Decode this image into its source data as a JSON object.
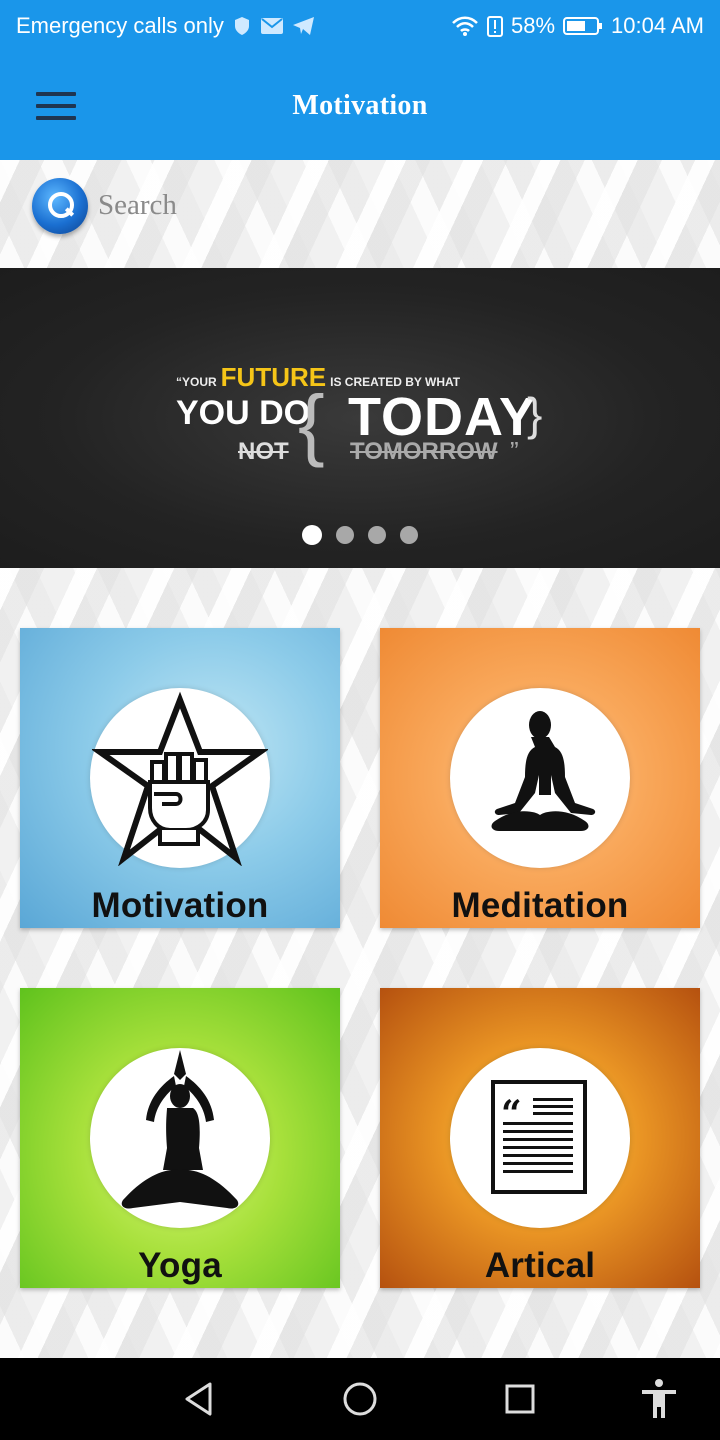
{
  "status_bar": {
    "carrier": "Emergency calls only",
    "battery": "58%",
    "time": "10:04 AM"
  },
  "app_bar": {
    "title": "Motivation"
  },
  "search": {
    "placeholder": "Search"
  },
  "banner": {
    "quote": {
      "open": "“YOUR",
      "future": "FUTURE",
      "is_created": "IS CREATED BY WHAT",
      "you_do": "YOU DO",
      "not": "NOT",
      "today": "TODAY",
      "tomorrow": "TOMORROW",
      "close": "”"
    },
    "dots_count": 4,
    "active_dot": 0
  },
  "categories": [
    {
      "label": "Motivation",
      "icon": "fist-star-icon"
    },
    {
      "label": "Meditation",
      "icon": "meditation-icon"
    },
    {
      "label": "Yoga",
      "icon": "yoga-icon"
    },
    {
      "label": "Artical",
      "icon": "article-quote-icon"
    }
  ]
}
